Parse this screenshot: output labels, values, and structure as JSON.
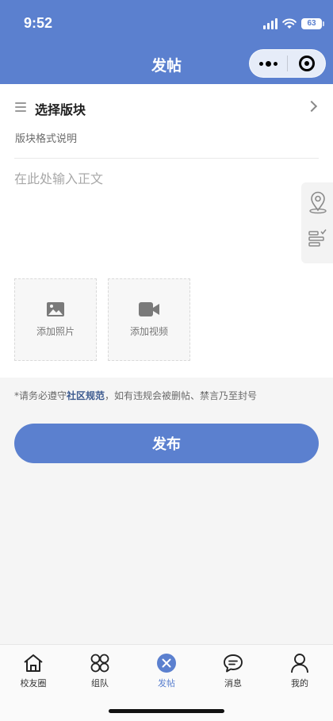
{
  "status_bar": {
    "time": "9:52",
    "battery": "63"
  },
  "header": {
    "title": "发帖"
  },
  "form": {
    "section_label": "选择版块",
    "format_hint": "版块格式说明",
    "body_placeholder": "在此处输入正文",
    "add_photo_label": "添加照片",
    "add_video_label": "添加视频"
  },
  "notice": {
    "prefix": "*请务必遵守",
    "link": "社区规范",
    "suffix": "，如有违规会被删帖、禁言乃至封号"
  },
  "publish_label": "发布",
  "tabbar": {
    "items": [
      {
        "label": "校友圈",
        "icon": "home-icon"
      },
      {
        "label": "组队",
        "icon": "clover-icon"
      },
      {
        "label": "发帖",
        "icon": "post-icon"
      },
      {
        "label": "消息",
        "icon": "chat-icon"
      },
      {
        "label": "我的",
        "icon": "user-icon"
      }
    ],
    "active_index": 2
  },
  "colors": {
    "primary": "#5b80cf",
    "link": "#3c5a8f",
    "background": "#f5f5f5"
  }
}
